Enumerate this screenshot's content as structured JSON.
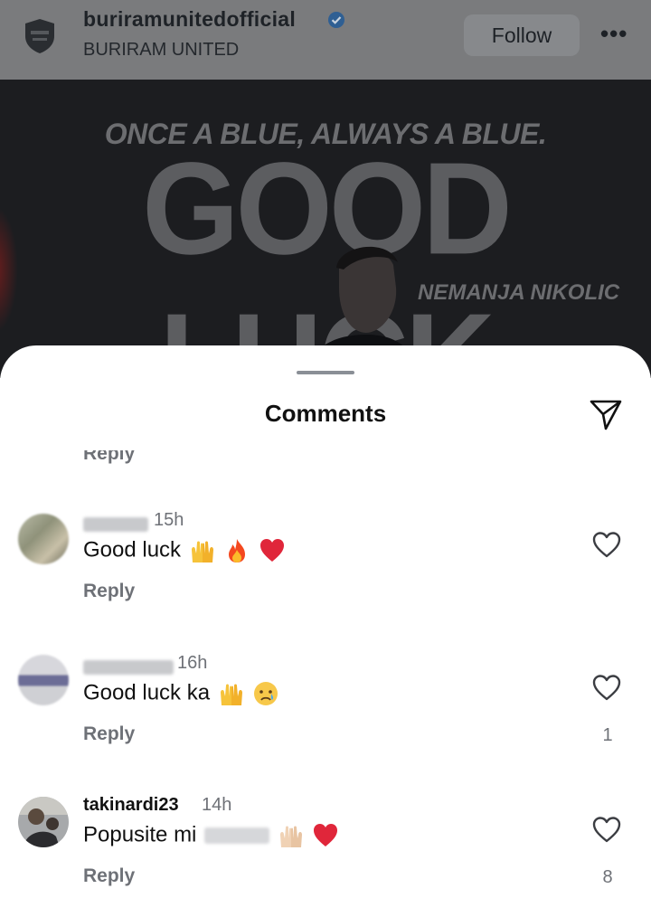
{
  "header": {
    "username": "buriramunitedofficial",
    "subtitle": "BURIRAM UNITED",
    "follow_label": "Follow",
    "more_label": "•••",
    "verified_icon": "verified-badge-icon"
  },
  "post": {
    "tagline": "ONCE A BLUE, ALWAYS A BLUE.",
    "headline": "GOOD LUCK",
    "player_name": "NEMANJA NIKOLIC"
  },
  "sheet": {
    "title": "Comments",
    "share_icon": "send-icon",
    "partial_reply_label": "Reply"
  },
  "comments": [
    {
      "author": "",
      "time": "15h",
      "text": "Good luck",
      "emojis": [
        "raising-hands",
        "fire",
        "red-heart"
      ],
      "reply_label": "Reply",
      "likes": ""
    },
    {
      "author": "",
      "time": "16h",
      "text": "Good luck ka",
      "emojis": [
        "raising-hands",
        "crying-face"
      ],
      "reply_label": "Reply",
      "likes": "1"
    },
    {
      "author": "takinardi23",
      "time": "14h",
      "text": "Popusite mi",
      "emojis": [
        "raising-hands",
        "red-heart"
      ],
      "reply_label": "Reply",
      "likes": "8"
    }
  ],
  "colors": {
    "header_bg": "#7a7b7d",
    "post_bg": "#1c1d20",
    "heart_red": "#e0263a",
    "secondary_text": "#6e7177"
  }
}
